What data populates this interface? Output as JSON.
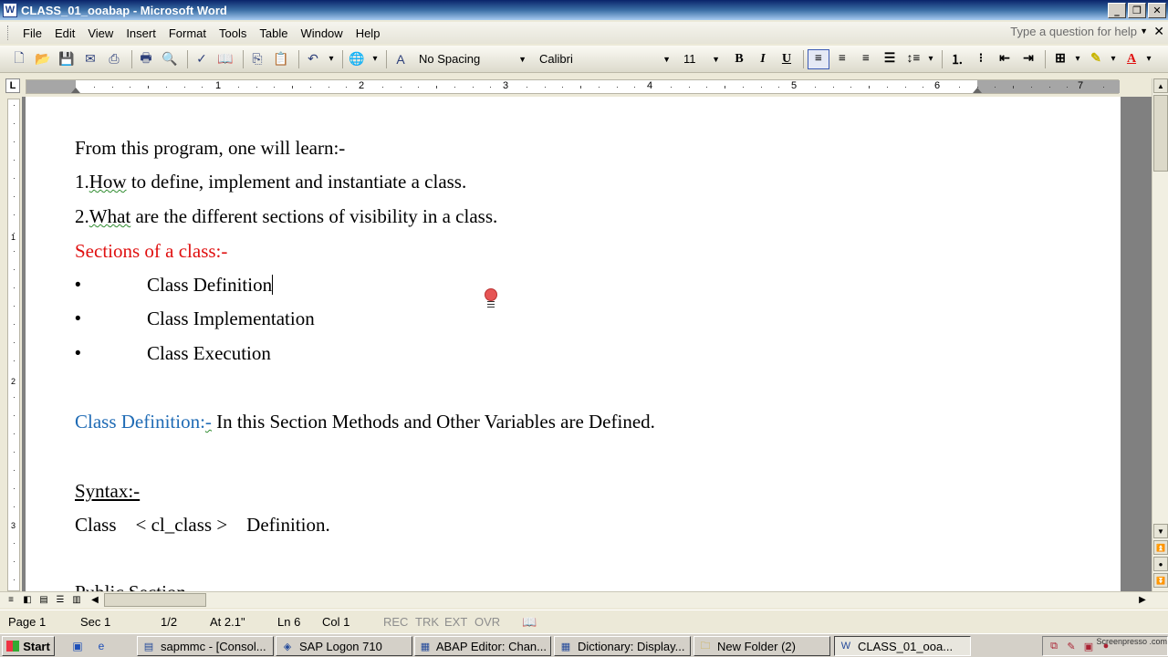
{
  "window": {
    "title": "CLASS_01_ooabap - Microsoft Word",
    "app_icon": "W",
    "controls": [
      "minimize-icon",
      "restore-icon",
      "close-icon"
    ]
  },
  "menu": {
    "items": [
      "File",
      "Edit",
      "View",
      "Insert",
      "Format",
      "Tools",
      "Table",
      "Window",
      "Help"
    ],
    "help_placeholder": "Type a question for help",
    "close_symbol": "✕"
  },
  "toolbar": {
    "style": "No Spacing",
    "font": "Calibri",
    "size": "11",
    "bold": "B",
    "italic": "I",
    "underline": "U",
    "font_color": "#e01010",
    "highlight_color": "#f4e800"
  },
  "ruler": {
    "numbers": [
      "1",
      "2",
      "3",
      "4",
      "5",
      "6",
      "7"
    ],
    "corner": "L",
    "vertical_numbers": [
      "1",
      "2",
      "3"
    ]
  },
  "document": {
    "intro": "From this program, one will learn:-",
    "point1_num": "1.",
    "point1_text": "How to define, implement and instantiate a class.",
    "point1_squiggle": "How",
    "point2_num": "2.",
    "point2_squiggle": "What",
    "point2_text": " are the different sections of visibility in a class.",
    "sections_heading": "Sections of a class:-",
    "bullets": [
      "Class Definition",
      "Class Implementation",
      "Class Execution"
    ],
    "bullet_symbol": "•",
    "def_label_plain": "Class Definition:",
    "def_label_squig": "-",
    "def_text": " In this Section Methods and Other Variables are Defined.",
    "syntax_heading": "Syntax:-",
    "syntax_line": "Class    < cl_class >    Definition.",
    "partial_line": "Public Section",
    "heading_red": "#e01010",
    "heading_blue": "#1f6bb5"
  },
  "statusbar": {
    "page": "Page 1",
    "sec": "Sec 1",
    "pages": "1/2",
    "at": "At 2.1\"",
    "ln": "Ln 6",
    "col": "Col 1",
    "rec": "REC",
    "trk": "TRK",
    "ext": "EXT",
    "ovr": "OVR"
  },
  "taskbar": {
    "start": "Start",
    "tasks": [
      {
        "label": "sapmmc - [Consol...",
        "icon": "sap-console-icon"
      },
      {
        "label": "SAP Logon 710",
        "icon": "sap-logon-icon"
      },
      {
        "label": "ABAP Editor: Chan...",
        "icon": "sap-window-icon"
      },
      {
        "label": "Dictionary: Display...",
        "icon": "sap-window-icon"
      },
      {
        "label": "New Folder (2)",
        "icon": "folder-icon"
      },
      {
        "label": "CLASS_01_ooa...",
        "icon": "word-icon"
      }
    ],
    "watermark": "Screenpresso .com"
  }
}
